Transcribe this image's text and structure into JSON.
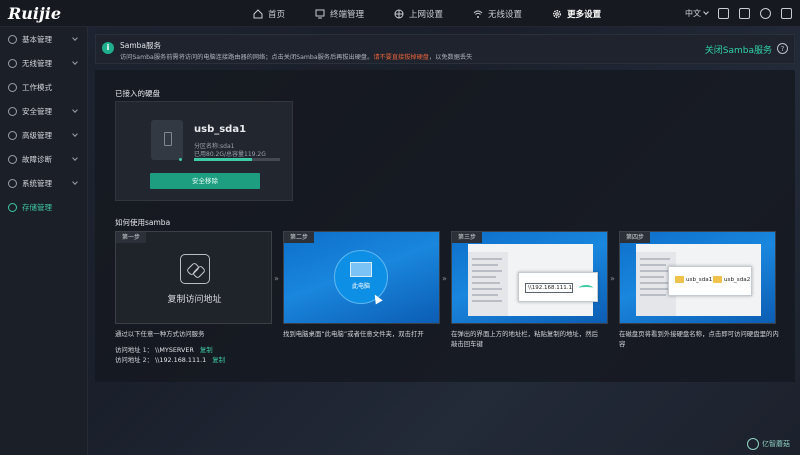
{
  "header": {
    "logo_text": "Ruijie",
    "nav": [
      {
        "label": "首页",
        "icon": "home-icon"
      },
      {
        "label": "终端管理",
        "icon": "terminal-icon"
      },
      {
        "label": "上网设置",
        "icon": "globe-icon"
      },
      {
        "label": "无线设置",
        "icon": "wifi-icon"
      },
      {
        "label": "更多设置",
        "icon": "gear-icon",
        "active": true
      }
    ],
    "language": "中文"
  },
  "sidebar": {
    "items": [
      {
        "label": "基本管理"
      },
      {
        "label": "无线管理"
      },
      {
        "label": "工作模式"
      },
      {
        "label": "安全管理"
      },
      {
        "label": "高级管理"
      },
      {
        "label": "故障诊断"
      },
      {
        "label": "系统管理"
      },
      {
        "label": "存储管理",
        "active": true
      }
    ]
  },
  "banner": {
    "title": "Samba服务",
    "desc_normal": "访问Samba服务前需将访问的电脑连接路由器的网络；点击关闭Samba服务后再拔出硬盘。",
    "desc_warn": "请不要直接拔掉硬盘",
    "desc_tail": "，以免数据丢失",
    "close_label": "关闭Samba服务",
    "help_label": "?"
  },
  "disk": {
    "section_title": "已接入的硬盘",
    "name": "usb_sda1",
    "partition": "分区名称:sda1",
    "usage": "已用80.2G/总容量119.2G",
    "used_fraction": 0.67,
    "eject_label": "安全移除"
  },
  "howto": {
    "section_title": "如何使用samba",
    "steps": [
      {
        "tag": "第一步",
        "image_label": "复制访问地址",
        "desc": "通过以下任意一种方式访问服务"
      },
      {
        "tag": "第二步",
        "image_label": "此电脑",
        "desc": "找到电脑桌面“此电脑”或者任意文件夹，双击打开"
      },
      {
        "tag": "第三步",
        "image_label": "\\\\192.168.111.1",
        "desc": "在弹出的界面上方的地址栏，粘贴复制的地址，然后敲击回车键"
      },
      {
        "tag": "第四步",
        "share_a": "usb_sda1",
        "share_b": "usb_sda2",
        "desc": "在磁盘页将看到外接硬盘名称，点击即可访问硬盘里的内容"
      }
    ],
    "addresses": [
      {
        "label": "访问地址 1：",
        "value": "\\\\MYSERVER",
        "copy": "复制"
      },
      {
        "label": "访问地址 2：",
        "value": "\\\\192.168.111.1",
        "copy": "复制"
      }
    ]
  },
  "watermark": "亿智蘑菇",
  "colors": {
    "accent": "#3ec9a7",
    "warn": "#e6623b",
    "button": "#1d9e80"
  }
}
